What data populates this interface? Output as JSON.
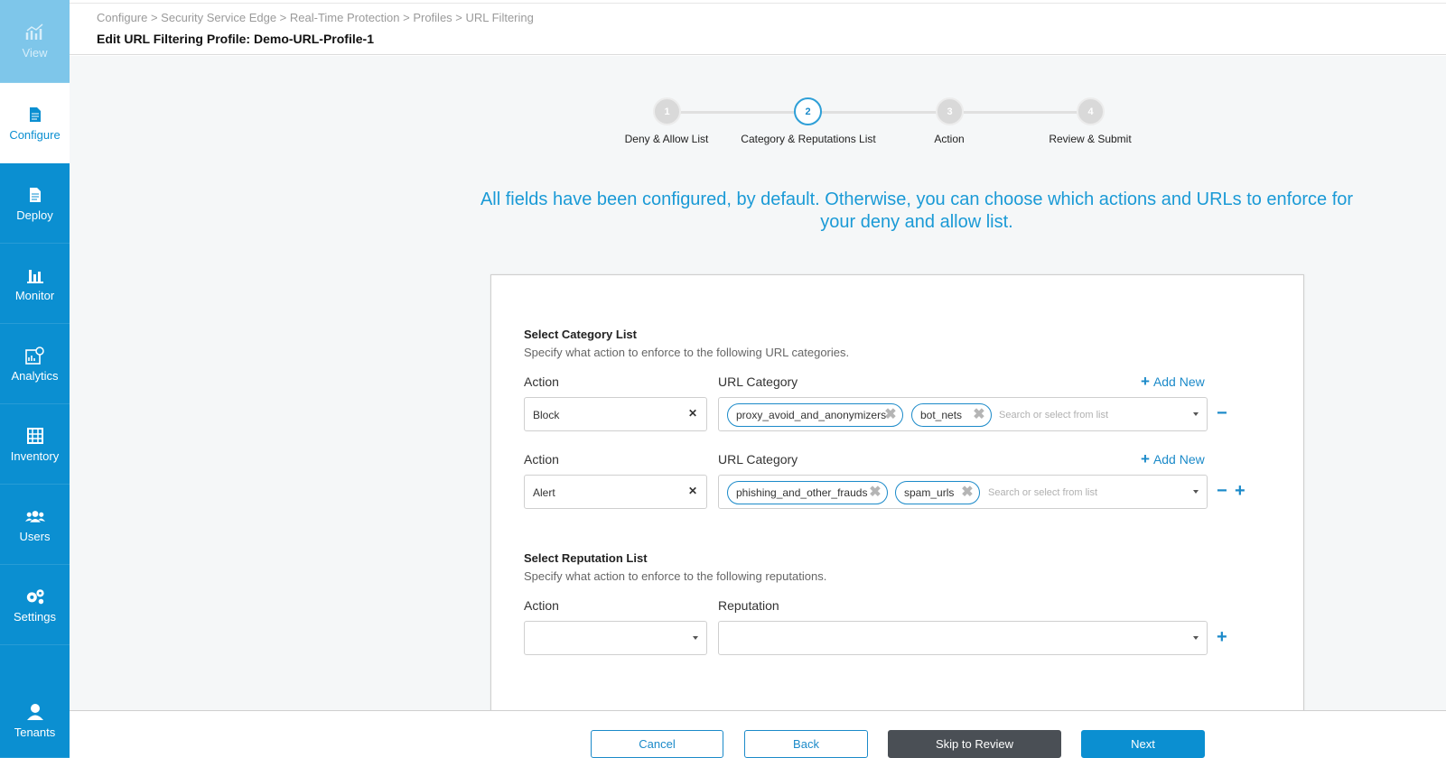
{
  "sidebar": {
    "items": [
      {
        "label": "View",
        "icon": "chart-icon"
      },
      {
        "label": "Configure",
        "icon": "document-icon"
      },
      {
        "label": "Deploy",
        "icon": "document-icon"
      },
      {
        "label": "Monitor",
        "icon": "bar-chart-icon"
      },
      {
        "label": "Analytics",
        "icon": "analytics-icon"
      },
      {
        "label": "Inventory",
        "icon": "inventory-icon"
      },
      {
        "label": "Users",
        "icon": "users-icon"
      },
      {
        "label": "Settings",
        "icon": "gear-icon"
      },
      {
        "label": "Tenants",
        "icon": "tenant-icon"
      }
    ]
  },
  "header": {
    "breadcrumb": "Configure > Security Service Edge > Real-Time Protection > Profiles > URL Filtering",
    "title": "Edit URL Filtering Profile: Demo-URL-Profile-1"
  },
  "stepper": {
    "steps": [
      {
        "number": "1",
        "label": "Deny & Allow List"
      },
      {
        "number": "2",
        "label": "Category & Reputations List"
      },
      {
        "number": "3",
        "label": "Action"
      },
      {
        "number": "4",
        "label": "Review & Submit"
      }
    ],
    "current": 2
  },
  "intro": "All fields have been configured, by default. Otherwise, you can choose which actions and URLs to enforce for your deny and allow list.",
  "category_section": {
    "title": "Select Category List",
    "description": "Specify what action to enforce to the following URL categories.",
    "action_label": "Action",
    "category_label": "URL Category",
    "add_new": "Add New",
    "placeholder": "Search or select from list",
    "rows": [
      {
        "action": "Block",
        "tags": [
          "proxy_avoid_and_anonymizers",
          "bot_nets"
        ]
      },
      {
        "action": "Alert",
        "tags": [
          "phishing_and_other_frauds",
          "spam_urls"
        ]
      }
    ]
  },
  "reputation_section": {
    "title": "Select Reputation List",
    "description": "Specify what action to enforce to the following reputations.",
    "action_label": "Action",
    "reputation_label": "Reputation"
  },
  "footer": {
    "cancel": "Cancel",
    "back": "Back",
    "skip": "Skip to Review",
    "next": "Next"
  },
  "colors": {
    "brand": "#0b8fd1",
    "accent_text": "#1a9ad6",
    "dark_button": "#4a4f55"
  }
}
